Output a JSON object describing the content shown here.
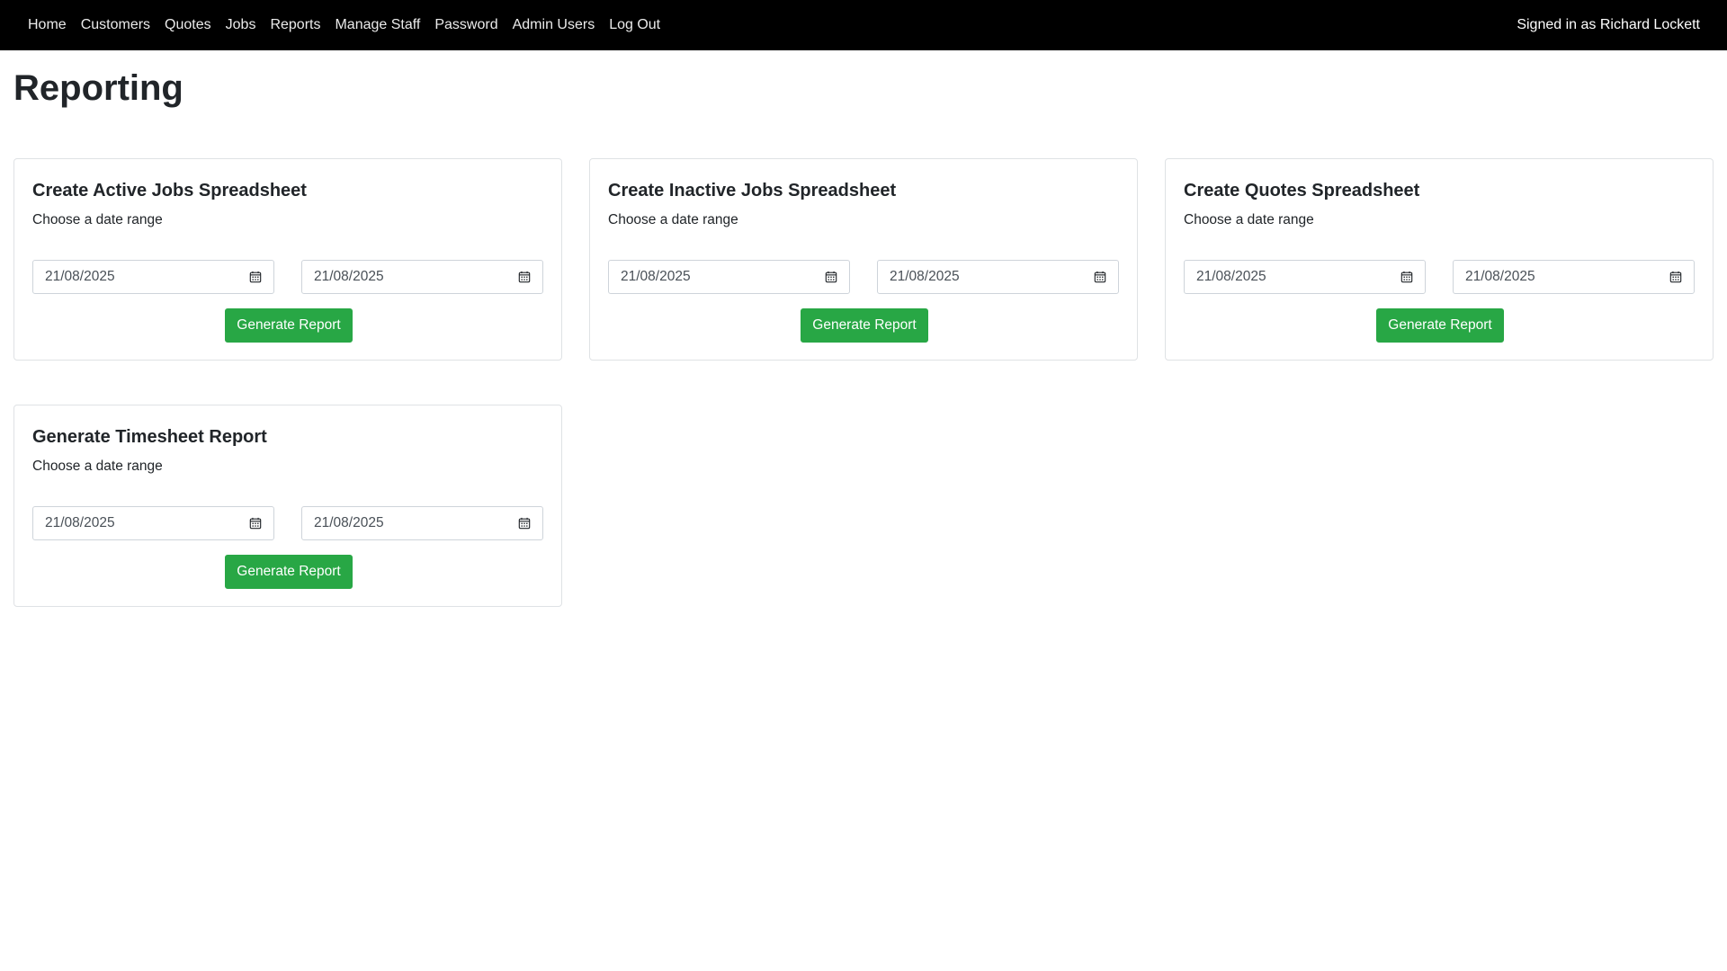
{
  "nav": {
    "items": [
      {
        "label": "Home"
      },
      {
        "label": "Customers"
      },
      {
        "label": "Quotes"
      },
      {
        "label": "Jobs"
      },
      {
        "label": "Reports"
      },
      {
        "label": "Manage Staff"
      },
      {
        "label": "Password"
      },
      {
        "label": "Admin Users"
      },
      {
        "label": "Log Out"
      }
    ],
    "signed_in": "Signed in as Richard Lockett"
  },
  "page": {
    "title": "Reporting"
  },
  "cards": [
    {
      "title": "Create Active Jobs Spreadsheet",
      "subtitle": "Choose a date range",
      "from_date": "21/08/2025",
      "to_date": "21/08/2025",
      "button_label": "Generate Report"
    },
    {
      "title": "Create Inactive Jobs Spreadsheet",
      "subtitle": "Choose a date range",
      "from_date": "21/08/2025",
      "to_date": "21/08/2025",
      "button_label": "Generate Report"
    },
    {
      "title": "Create Quotes Spreadsheet",
      "subtitle": "Choose a date range",
      "from_date": "21/08/2025",
      "to_date": "21/08/2025",
      "button_label": "Generate Report"
    },
    {
      "title": "Generate Timesheet Report",
      "subtitle": "Choose a date range",
      "from_date": "21/08/2025",
      "to_date": "21/08/2025",
      "button_label": "Generate Report"
    }
  ],
  "icons": {
    "date_picker": "calendar-icon"
  },
  "colors": {
    "navbar_bg": "#000000",
    "button_green": "#28a745",
    "card_border": "#dfe2e5"
  }
}
